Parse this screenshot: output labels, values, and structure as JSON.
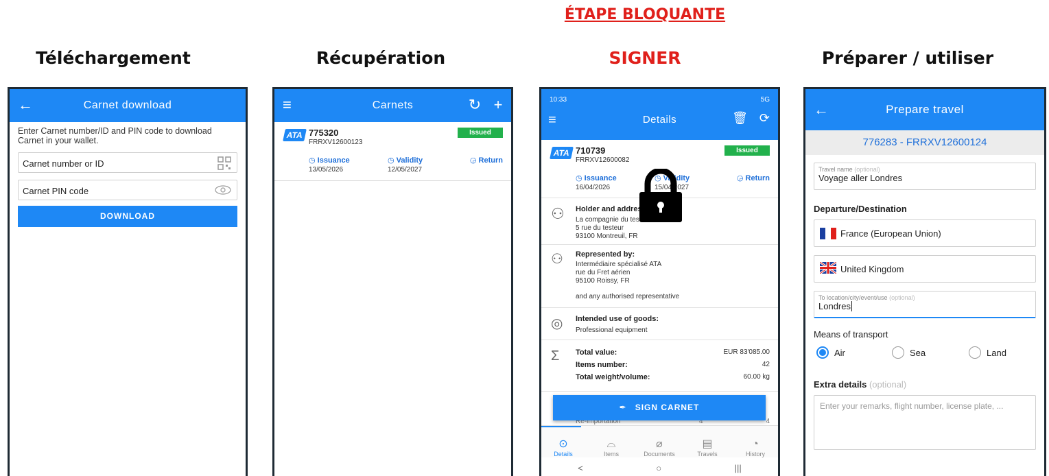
{
  "banner": "ÉTAPE BLOQUANTE",
  "headings": [
    "Téléchargement",
    "Récupération",
    "SIGNER",
    "Préparer / utiliser"
  ],
  "colors": {
    "accent": "#1e88f5",
    "warning": "#e0201b",
    "issued": "#22b14c"
  },
  "download": {
    "title": "Carnet download",
    "instructions": "Enter Carnet number/ID and PIN code to download Carnet in your wallet.",
    "number_placeholder": "Carnet number or ID",
    "pin_placeholder": "Carnet PIN code",
    "button": "DOWNLOAD"
  },
  "carnets": {
    "title": "Carnets",
    "item": {
      "logo": "ATA",
      "number": "775320",
      "reference": "FRRXV12600123",
      "status": "Issued",
      "issuance_label": "Issuance",
      "issuance_date": "13/05/2026",
      "validity_label": "Validity",
      "validity_date": "12/05/2027",
      "return_label": "Return"
    }
  },
  "details": {
    "status_bar": {
      "time": "10:33",
      "right": "5G"
    },
    "title": "Details",
    "carnet": {
      "logo": "ATA",
      "number": "710739",
      "reference": "FRRXV12600082",
      "status": "Issued",
      "issuance_label": "Issuance",
      "issuance_date": "16/04/2026",
      "validity_label": "Validity",
      "validity_date": "15/04/2027",
      "return_label": "Return"
    },
    "holder": {
      "title": "Holder and address",
      "line1": "La compagnie du test 2025",
      "line2": "5 rue du testeur",
      "line3": "93100 Montreuil, FR"
    },
    "represented": {
      "title": "Represented by:",
      "line1": "Intermédiaire spécialisé ATA",
      "line2": "rue du Fret aérien",
      "line3": "95100 Roissy, FR",
      "note": "and any authorised representative"
    },
    "intended": {
      "title": "Intended use of goods:",
      "value": "Professional equipment"
    },
    "totals": {
      "value_label": "Total value:",
      "value": "EUR 83'085.00",
      "items_label": "Items number:",
      "items": "42",
      "weight_label": "Total weight/volume:",
      "weight": "60.00 kg"
    },
    "sign_button": "SIGN CARNET",
    "behind": {
      "row1": "Re-importation",
      "row1_a": "4",
      "row1_b": "4"
    },
    "tabs": [
      "Details",
      "Items",
      "Documents",
      "Travels",
      "History"
    ],
    "nav": [
      "<",
      "○",
      "|||"
    ]
  },
  "prepare": {
    "title": "Prepare travel",
    "carnet_ref": "776283 - FRRXV12600124",
    "travel_name_label": "Travel name",
    "optional": "(optional)",
    "travel_name": "Voyage aller Londres",
    "departure_destination": "Departure/Destination",
    "departure": "France (European Union)",
    "destination": "United Kingdom",
    "location_label": "To location/city/event/use",
    "location": "Londres",
    "transport_label": "Means of transport",
    "transport_options": [
      "Air",
      "Sea",
      "Land"
    ],
    "transport_selected": "Air",
    "extra_label": "Extra details",
    "extra_placeholder": "Enter your remarks, flight number, license plate, ..."
  }
}
